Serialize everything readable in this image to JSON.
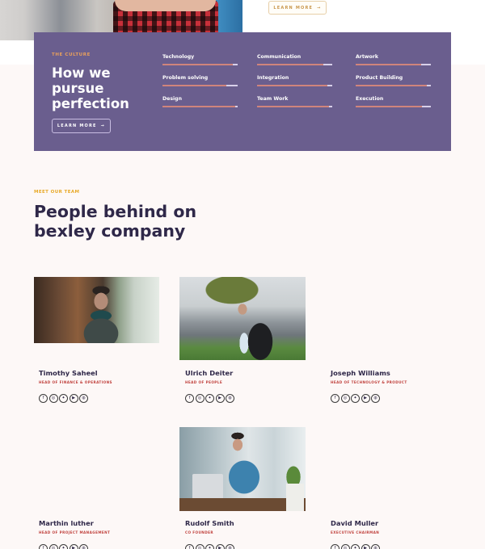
{
  "hero": {
    "learn_more_label": "LEARN MORE",
    "arrow_icon": "→"
  },
  "culture": {
    "eyebrow": "THE CULTURE",
    "title": "How we pursue perfection",
    "learn_more_label": "LEARN MORE",
    "arrow_icon": "→",
    "skills": [
      {
        "label": "Technology",
        "progress": 0.94
      },
      {
        "label": "Problem solving",
        "progress": 0.85
      },
      {
        "label": "Design",
        "progress": 0.97
      },
      {
        "label": "Communication",
        "progress": 0.88
      },
      {
        "label": "Integration",
        "progress": 0.94
      },
      {
        "label": "Team Work",
        "progress": 0.96
      },
      {
        "label": "Artwork",
        "progress": 0.87
      },
      {
        "label": "Product Building",
        "progress": 0.95
      },
      {
        "label": "Execution",
        "progress": 0.88
      }
    ]
  },
  "team": {
    "eyebrow": "MEET OUR TEAM",
    "title": "People behind on bexley company",
    "social_icons": [
      {
        "name": "facebook",
        "glyph": "f"
      },
      {
        "name": "instagram",
        "glyph": "◎"
      },
      {
        "name": "twitter",
        "glyph": "✦"
      },
      {
        "name": "youtube",
        "glyph": "▶"
      },
      {
        "name": "dribbble",
        "glyph": "◍"
      }
    ],
    "members": [
      {
        "name": "Timothy Saheel",
        "role": "HEAD OF FINANCE & OPERATIONS",
        "has_photo": true
      },
      {
        "name": "Ulrich Deiter",
        "role": "HEAD OF PEOPLE",
        "has_photo": true
      },
      {
        "name": "Joseph Williams",
        "role": "HEAD OF TECHNOLOGY & PRODUCT",
        "has_photo": false
      },
      {
        "name": "Marthin luther",
        "role": "HEAD OF PROJECT MANAGEMENT",
        "has_photo": false
      },
      {
        "name": "Rudolf Smith",
        "role": "CO FOUNDER",
        "has_photo": true
      },
      {
        "name": "David Muller",
        "role": "EXECUTIVE CHAIRMAN",
        "has_photo": false
      }
    ]
  },
  "colors": {
    "culture_bg": "#6a5e8e",
    "accent_orange": "#e8a05c",
    "accent_yellow": "#e8a928",
    "role_red": "#c0403c",
    "heading_dark": "#2f2849",
    "page_bg": "#fdf8f7"
  }
}
